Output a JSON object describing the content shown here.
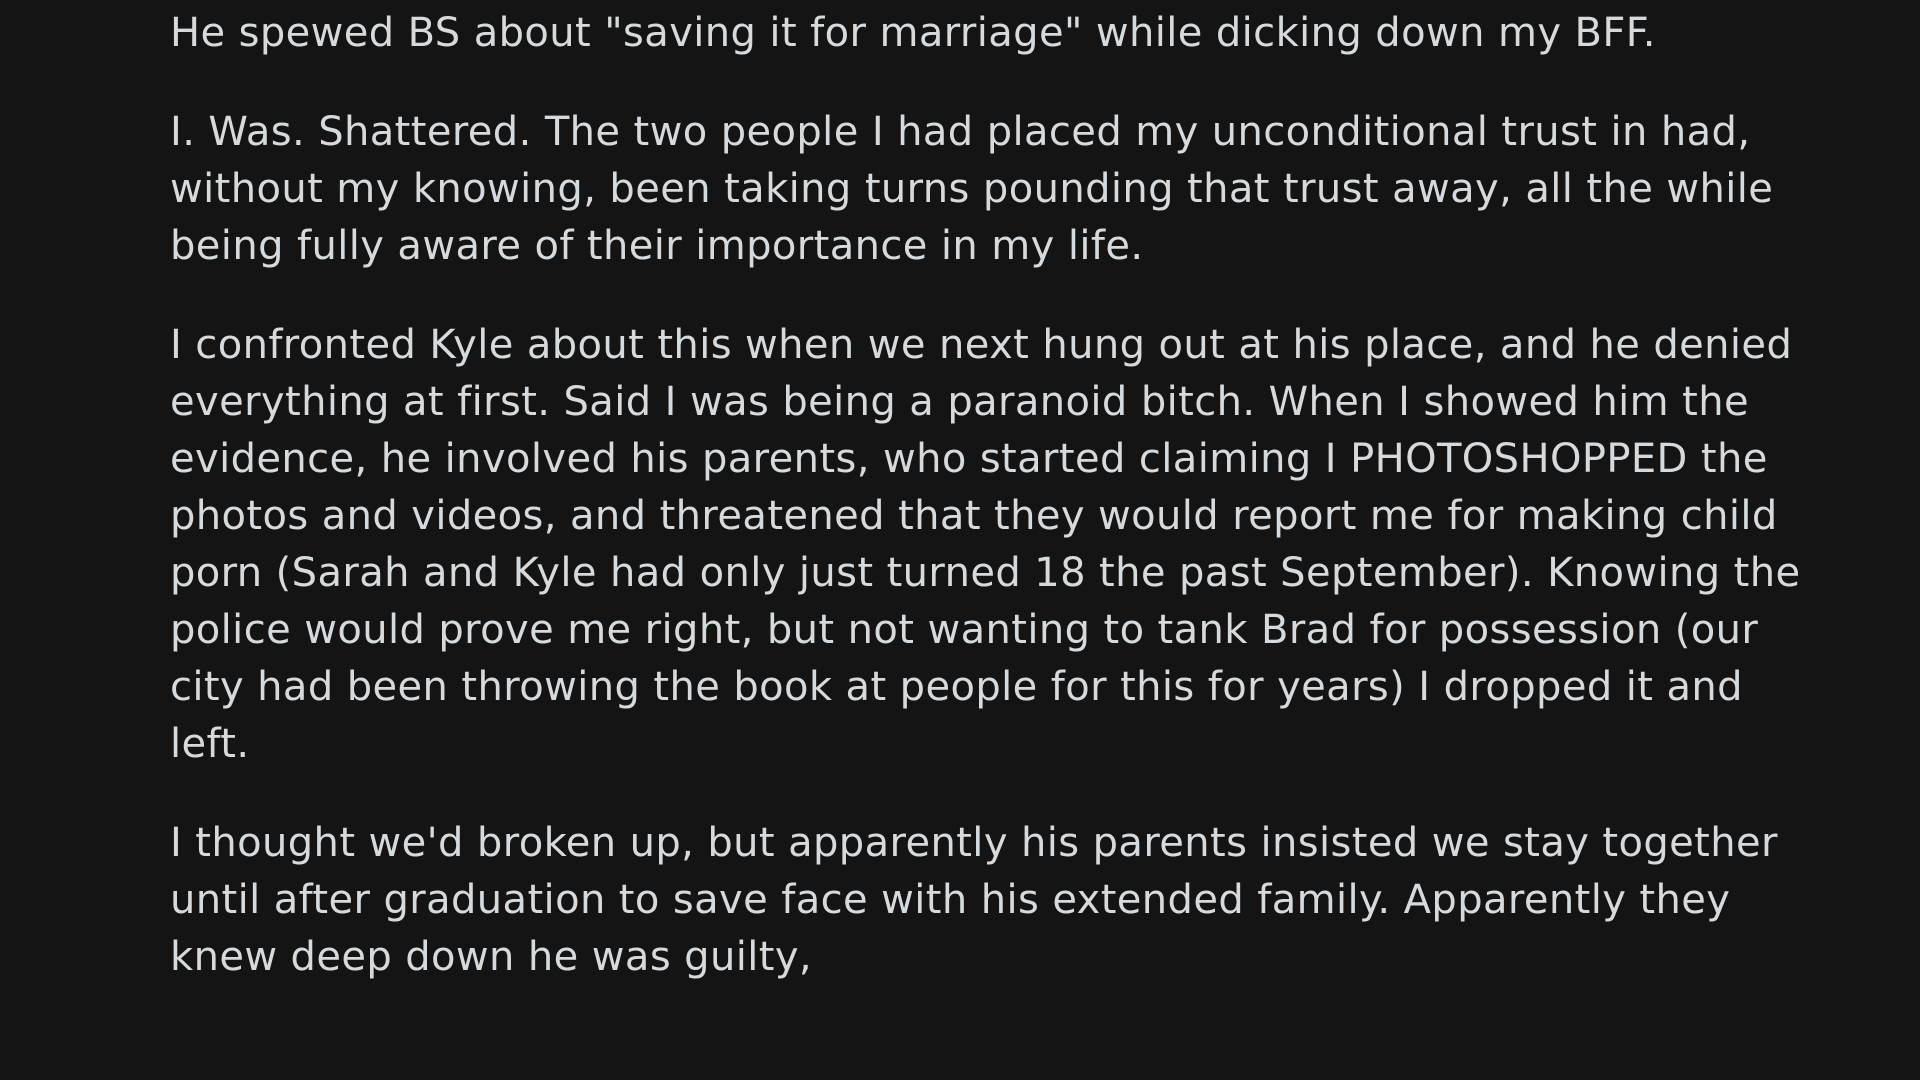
{
  "post": {
    "paragraphs": [
      {
        "lines": [
          "He spewed BS about \"saving it for marriage\" while dicking down my BFF."
        ]
      },
      {
        "lines": [
          "I. Was. Shattered. The two people I had placed my unconditional trust in had,",
          "without my knowing, been taking turns pounding that trust away, all the while",
          "being fully aware of their importance in my life."
        ]
      },
      {
        "lines": [
          "I confronted Kyle about this when we next hung out at his place, and he denied",
          "everything at first. Said I was being a paranoid bitch. When I showed him the",
          "evidence, he involved his parents, who started claiming I PHOTOSHOPPED the",
          "photos and videos, and threatened that they would report me for making child",
          "porn (Sarah and Kyle had only just turned 18 the past September). Knowing the",
          "police would prove me right, but not wanting to tank Brad for possession (our",
          "city had been throwing the book at people for this for years) I dropped it and",
          "left."
        ]
      },
      {
        "lines": [
          "I thought we'd broken up, but apparently his parents insisted we stay together",
          "until after graduation to save face with his extended family. Apparently they",
          "knew deep down he was guilty,"
        ]
      }
    ]
  }
}
